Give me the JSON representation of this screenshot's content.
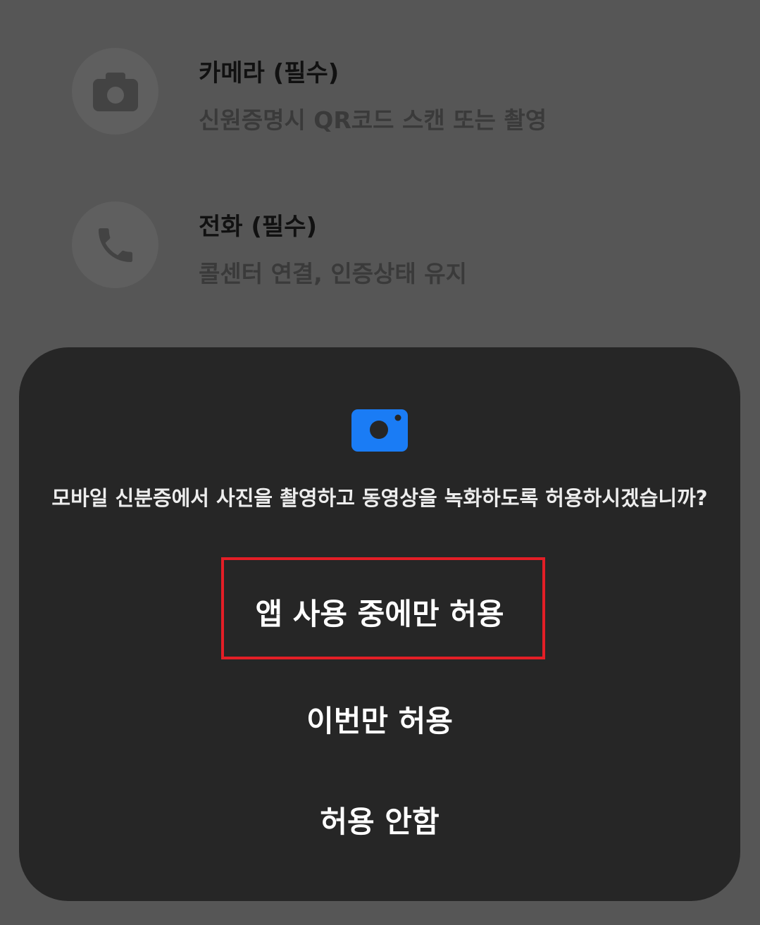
{
  "background_list": {
    "items": [
      {
        "icon": "camera-icon",
        "title": "카메라 (필수)",
        "description": "신원증명시 QR코드 스캔 또는 촬영"
      },
      {
        "icon": "phone-icon",
        "title": "전화 (필수)",
        "description": "콜센터 연결, 인증상태 유지"
      }
    ]
  },
  "dialog": {
    "icon": "camera-icon",
    "icon_color": "#1a7cf5",
    "message": "모바일 신분증에서 사진을 촬영하고 동영상을 녹화하도록 허용하시겠습니까?",
    "buttons": {
      "while_using": "앱 사용 중에만 허용",
      "only_once": "이번만 허용",
      "deny": "허용 안함"
    }
  },
  "annotation": {
    "highlight_color": "#e31e26"
  }
}
